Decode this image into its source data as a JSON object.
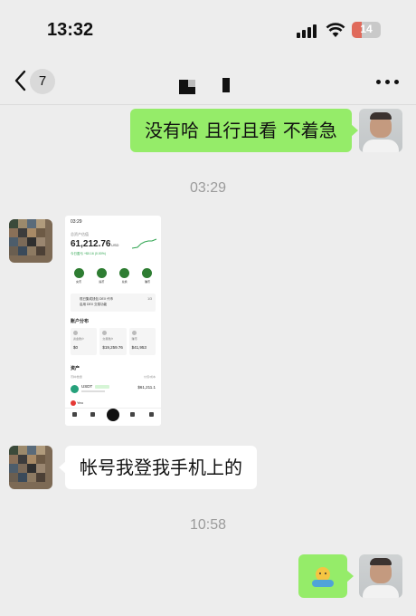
{
  "status_bar": {
    "time": "13:32",
    "battery": "14",
    "battery_level": 0.14
  },
  "nav": {
    "unread_count": "7"
  },
  "messages": {
    "msg1": "没有哈 且行且看 不着急",
    "time1": "03:29",
    "msg3": "帐号我登我手机上的",
    "time2": "10:58"
  },
  "screenshot": {
    "time": "03:29",
    "total_label": "总资产估值",
    "total_value": "61,212.76",
    "unit": "USD",
    "pnl": "今日盈亏 +$0.16 (0.00%)",
    "actions": [
      "充币",
      "提币",
      "兑换",
      "赚币"
    ],
    "dex_line1": "现已集成钱包 DEX 代币",
    "dex_line2": "启用 DEX 交易功能",
    "dex_value": "1/3",
    "distribution": "账户分布",
    "cards": [
      {
        "name": "资金账户",
        "value": "$0"
      },
      {
        "name": "交易账户",
        "value": "$19,259.76"
      },
      {
        "name": "赚币",
        "value": "$41,953"
      }
    ],
    "assets": "资产",
    "assets_sub": "币种/数量",
    "assets_sub2": "价值/成本",
    "row1_name": "USDT",
    "row1_value": "$61,211.1",
    "row2_name": "Yeo"
  },
  "colors": {
    "bubble_self": "#95ec69",
    "bubble_other": "#ffffff",
    "background": "#ededed"
  }
}
